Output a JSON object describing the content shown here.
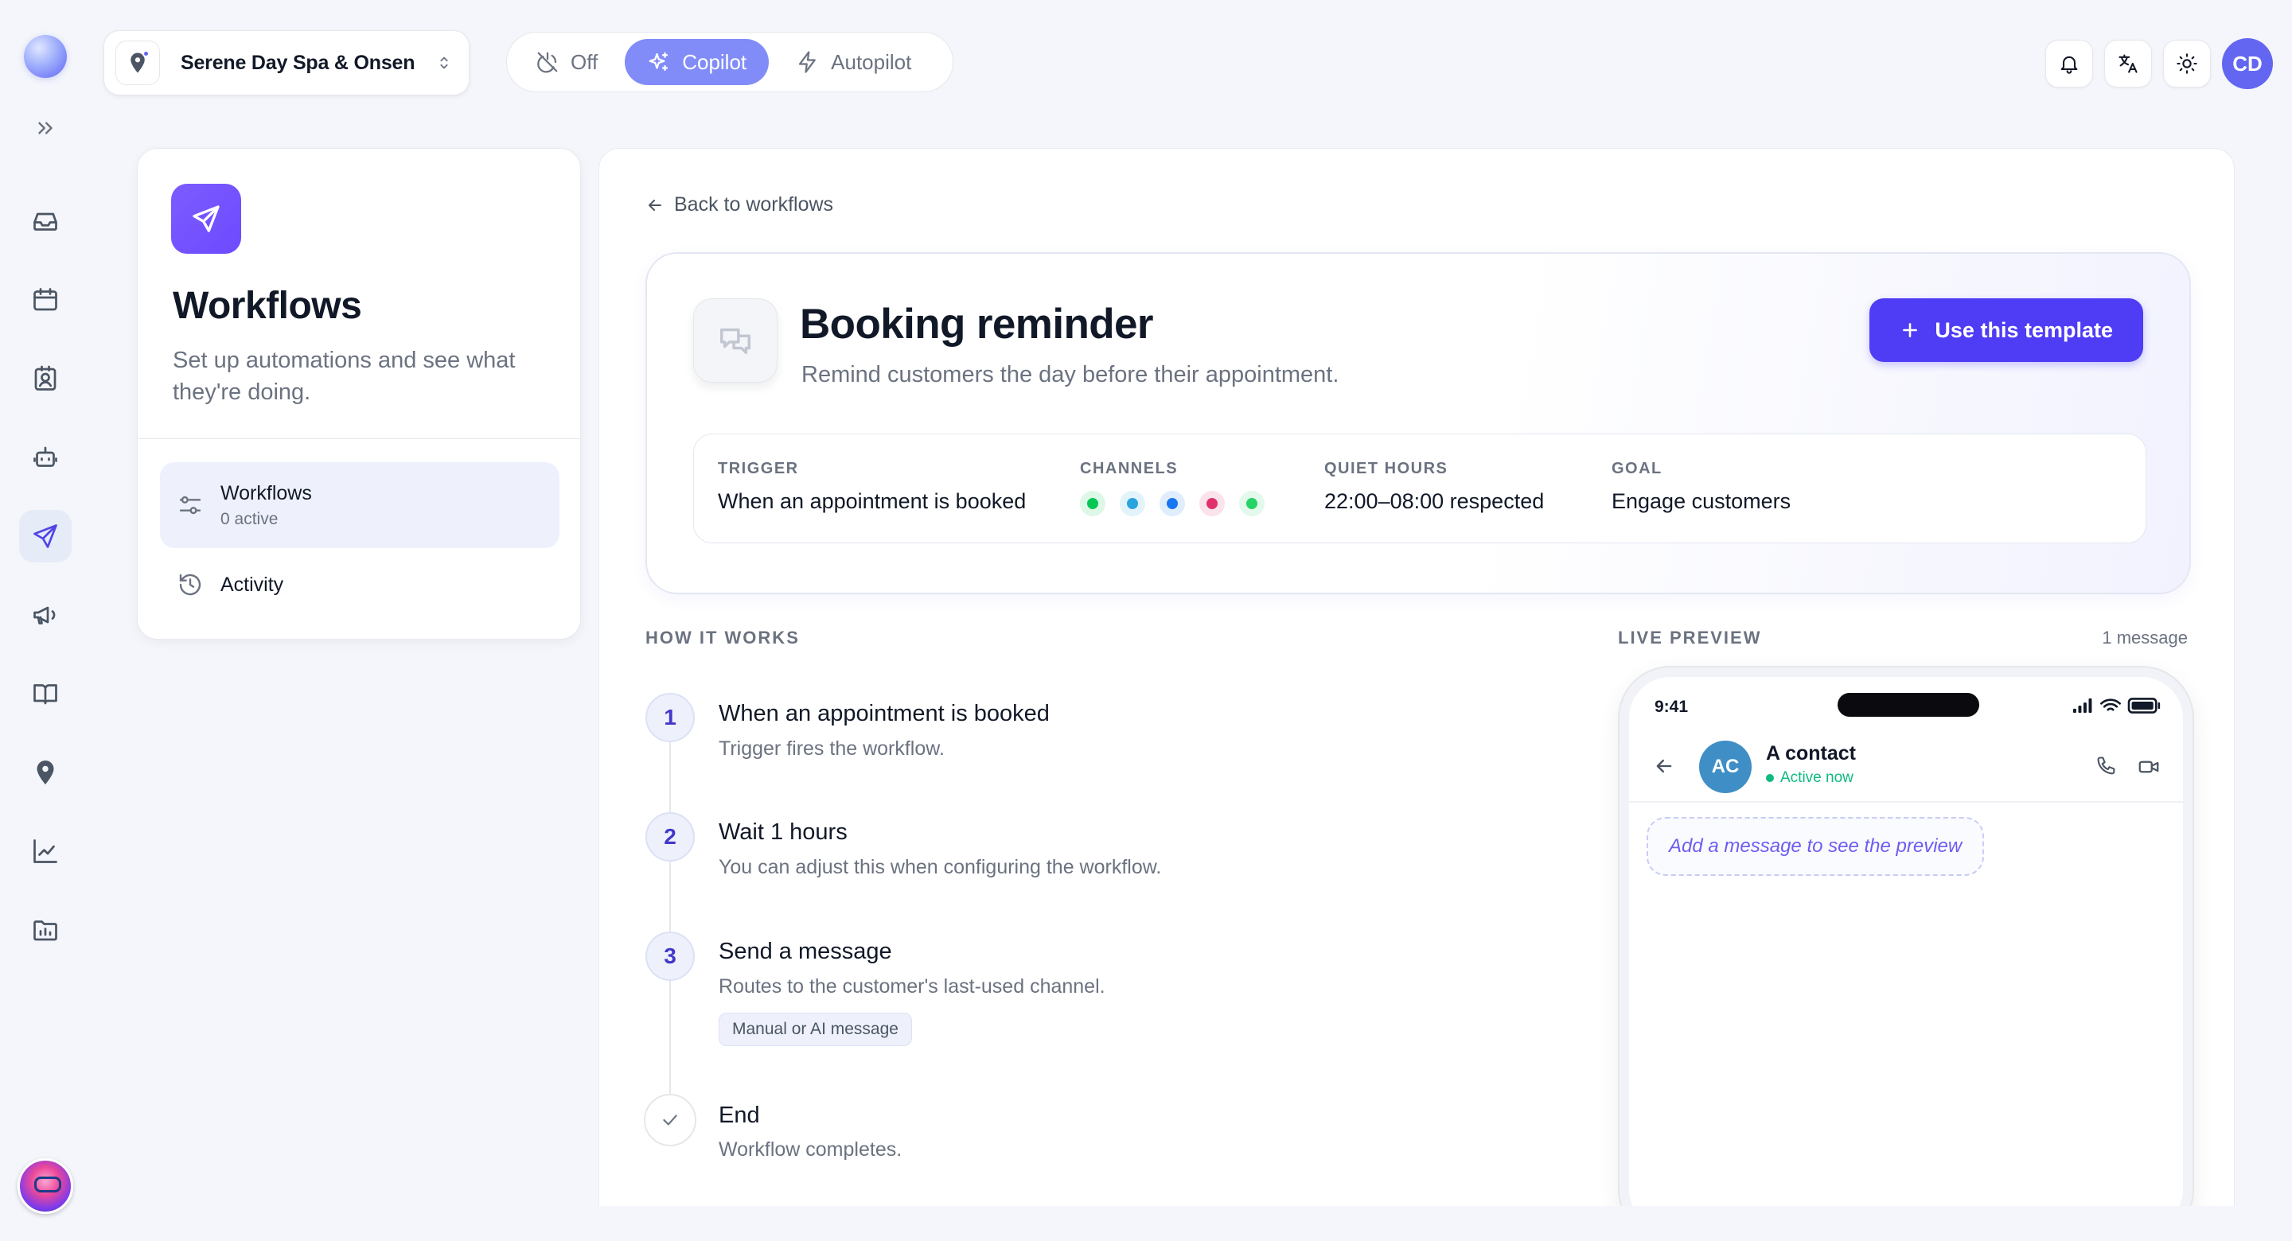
{
  "business": {
    "name": "Serene Day Spa & Onsen"
  },
  "modes": [
    {
      "label": "Off",
      "icon": "power-off-icon",
      "active": false
    },
    {
      "label": "Copilot",
      "icon": "sparkles-icon",
      "active": true
    },
    {
      "label": "Autopilot",
      "icon": "lightning-icon",
      "active": false
    }
  ],
  "user": {
    "initials": "CD"
  },
  "sidebar_nav": [
    "inbox-icon",
    "calendar-icon",
    "contacts-icon",
    "bot-icon",
    "send-icon",
    "megaphone-icon",
    "book-icon",
    "location-icon",
    "chart-icon",
    "reports-icon"
  ],
  "side_panel": {
    "title": "Workflows",
    "subtitle": "Set up automations and see what they're doing.",
    "items": [
      {
        "label": "Workflows",
        "meta": "0 active",
        "active": true
      },
      {
        "label": "Activity",
        "active": false
      }
    ]
  },
  "main": {
    "back_label": "Back to workflows",
    "template": {
      "title": "Booking reminder",
      "subtitle": "Remind customers the day before their appointment.",
      "use_button": "Use this template",
      "trigger_label": "TRIGGER",
      "trigger_value": "When an appointment is booked",
      "channels_label": "CHANNELS",
      "channels": [
        {
          "name": "line",
          "color": "#06c755"
        },
        {
          "name": "telegram",
          "color": "#2aa3df"
        },
        {
          "name": "messenger",
          "color": "#1877f2"
        },
        {
          "name": "instagram",
          "color": "#e1306c"
        },
        {
          "name": "whatsapp",
          "color": "#25d366"
        }
      ],
      "quiet_label": "QUIET HOURS",
      "quiet_value": "22:00–08:00 respected",
      "goal_label": "GOAL",
      "goal_value": "Engage customers"
    },
    "how_label": "HOW IT WORKS",
    "steps": [
      {
        "num": "1",
        "title": "When an appointment is booked",
        "desc": "Trigger fires the workflow."
      },
      {
        "num": "2",
        "title": "Wait 1 hours",
        "desc": "You can adjust this when configuring the workflow."
      },
      {
        "num": "3",
        "title": "Send a message",
        "desc": "Routes to the customer's last-used channel.",
        "tag": "Manual or AI message"
      },
      {
        "title": "End",
        "desc": "Workflow completes."
      }
    ],
    "preview": {
      "label": "LIVE PREVIEW",
      "count": "1 message",
      "time": "9:41",
      "contact_initials": "AC",
      "contact_name": "A contact",
      "status": "Active now",
      "placeholder": "Add a message to see the preview"
    }
  }
}
